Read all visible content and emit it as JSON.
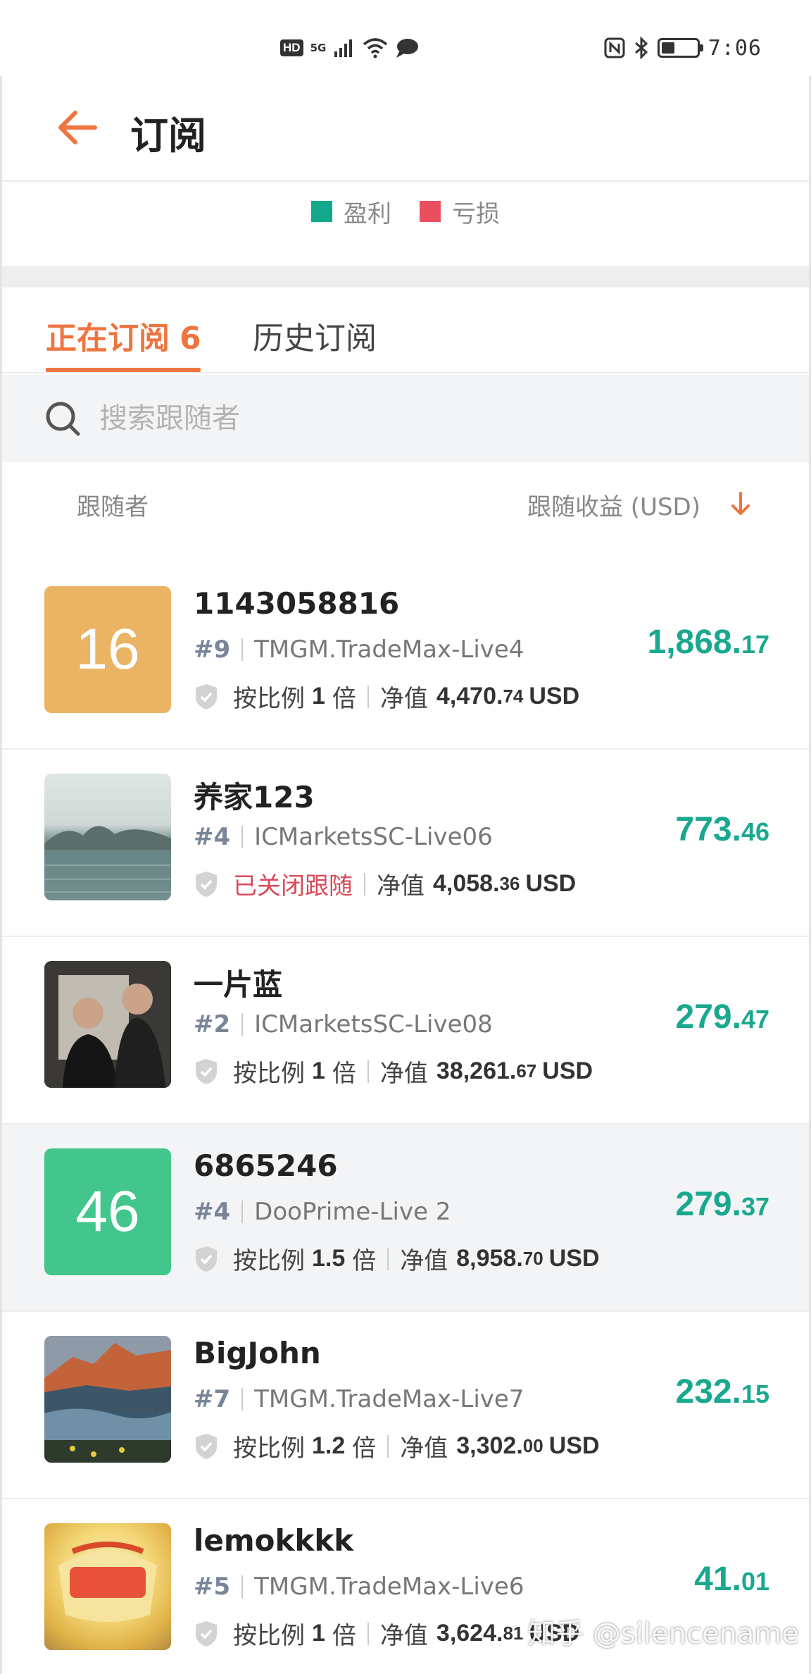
{
  "status_bar": {
    "hd": "HD",
    "network": "5G",
    "time": "7:06"
  },
  "header": {
    "title": "订阅",
    "back_icon": "arrow-left-icon"
  },
  "legend": [
    {
      "label": "盈利",
      "color": "#13a88c"
    },
    {
      "label": "亏损",
      "color": "#e94f5f"
    }
  ],
  "tabs": {
    "active_label": "正在订阅",
    "active_count": "6",
    "history_label": "历史订阅"
  },
  "search": {
    "placeholder": "搜索跟随者"
  },
  "columns": {
    "left": "跟随者",
    "right": "跟随收益 (USD)"
  },
  "accent_color": "#ee7440",
  "profit_color": "#1aa88e",
  "followers": [
    {
      "name": "1143058816",
      "avatar_text": "16",
      "avatar_color": "#eab464",
      "rank": "#9",
      "server": "TMGM.TradeMax-Live4",
      "ratio_prefix": "按比例",
      "ratio": "1",
      "ratio_suffix": "倍",
      "nv_label": "净值",
      "nv_big": "4,470.",
      "nv_small": "74",
      "nv_unit": "USD",
      "profit_big": "1,868.",
      "profit_small": "17"
    },
    {
      "name": "养家123",
      "rank": "#4",
      "server": "ICMarketsSC-Live06",
      "status": "已关闭跟随",
      "nv_label": "净值",
      "nv_big": "4,058.",
      "nv_small": "36",
      "nv_unit": "USD",
      "profit_big": "773.",
      "profit_small": "46"
    },
    {
      "name": "一片蓝",
      "rank": "#2",
      "server": "ICMarketsSC-Live08",
      "ratio_prefix": "按比例",
      "ratio": "1",
      "ratio_suffix": "倍",
      "nv_label": "净值",
      "nv_big": "38,261.",
      "nv_small": "67",
      "nv_unit": "USD",
      "profit_big": "279.",
      "profit_small": "47"
    },
    {
      "name": "6865246",
      "avatar_text": "46",
      "avatar_color": "#42c68c",
      "rank": "#4",
      "server": "DooPrime-Live 2",
      "ratio_prefix": "按比例",
      "ratio": "1.5",
      "ratio_suffix": "倍",
      "nv_label": "净值",
      "nv_big": "8,958.",
      "nv_small": "70",
      "nv_unit": "USD",
      "profit_big": "279.",
      "profit_small": "37"
    },
    {
      "name": "BigJohn",
      "rank": "#7",
      "server": "TMGM.TradeMax-Live7",
      "ratio_prefix": "按比例",
      "ratio": "1.2",
      "ratio_suffix": "倍",
      "nv_label": "净值",
      "nv_big": "3,302.",
      "nv_small": "00",
      "nv_unit": "USD",
      "profit_big": "232.",
      "profit_small": "15"
    },
    {
      "name": "lemokkkk",
      "rank": "#5",
      "server": "TMGM.TradeMax-Live6",
      "ratio_prefix": "按比例",
      "ratio": "1",
      "ratio_suffix": "倍",
      "nv_label": "净值",
      "nv_big": "3,624.",
      "nv_small": "81",
      "nv_unit": "USD",
      "profit_big": "41.",
      "profit_small": "01"
    }
  ],
  "watermark": "知乎 @silencename"
}
